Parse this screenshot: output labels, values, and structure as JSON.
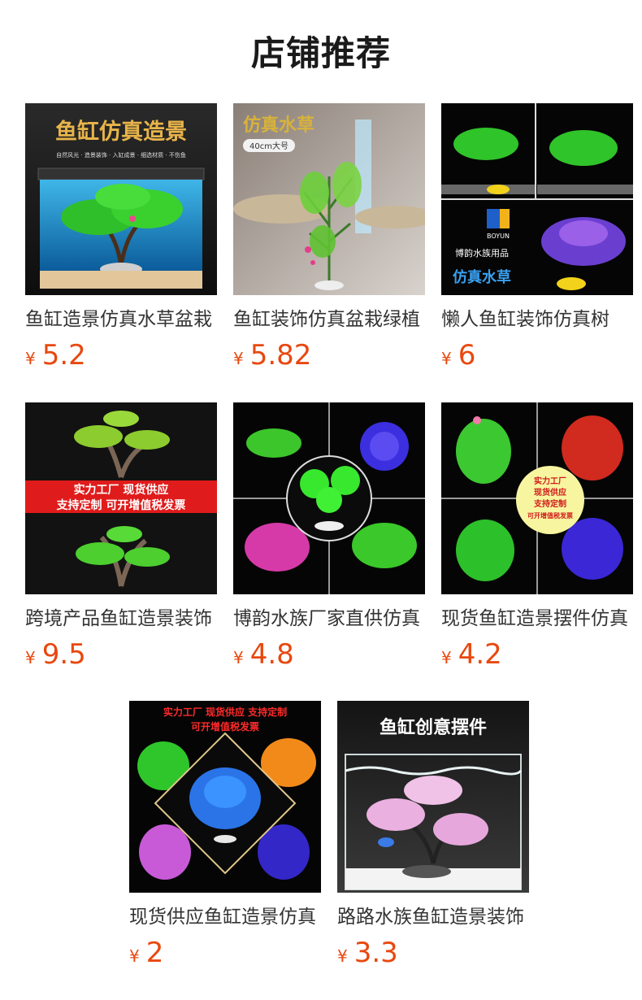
{
  "header": {
    "title": "店铺推荐"
  },
  "currency_symbol": "¥",
  "colors": {
    "price": "#e8480f",
    "title": "#1a1a1a"
  },
  "products": [
    {
      "name": "鱼缸造景仿真水草盆栽",
      "price": "5.2",
      "image_text": {
        "headline": "鱼缸仿真造景",
        "sub": "自然风光 · 造景装饰 · 入缸成景 · 细选材质 · 不伤鱼"
      }
    },
    {
      "name": "鱼缸装饰仿真盆栽绿植",
      "price": "5.82",
      "image_text": {
        "headline": "仿真水草",
        "badge": "40cm大号"
      }
    },
    {
      "name": "懒人鱼缸装饰仿真树",
      "price": "6",
      "image_text": {
        "brand_cn": "博韵水族用品",
        "brand_en": "BOYUN",
        "tag": "仿真水草"
      }
    },
    {
      "name": "跨境产品鱼缸造景装饰",
      "price": "9.5",
      "image_text": {
        "banner_line1": "实力工厂 现货供应",
        "banner_line2": "支持定制 可开增值税发票"
      }
    },
    {
      "name": "博韵水族厂家直供仿真",
      "price": "4.8",
      "image_text": {}
    },
    {
      "name": "现货鱼缸造景摆件仿真",
      "price": "4.2",
      "image_text": {
        "l1": "实力工厂",
        "l2": "现货供应",
        "l3": "支持定制",
        "l4": "可开增值税发票"
      }
    },
    {
      "name": "现货供应鱼缸造景仿真",
      "price": "2",
      "image_text": {
        "top1": "实力工厂  现货供应  支持定制",
        "top2": "可开增值税发票"
      }
    },
    {
      "name": "路路水族鱼缸造景装饰",
      "price": "3.3",
      "image_text": {
        "headline": "鱼缸创意摆件"
      }
    }
  ]
}
